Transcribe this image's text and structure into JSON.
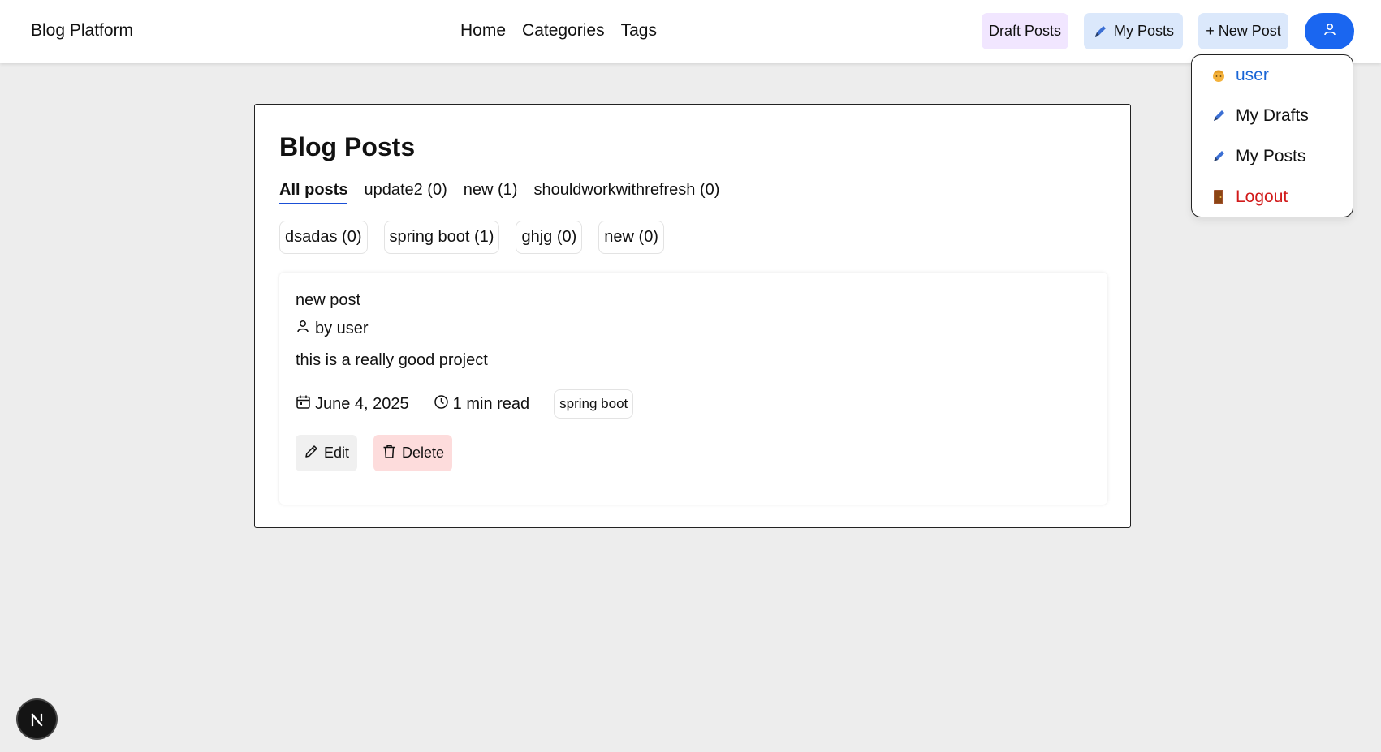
{
  "navbar": {
    "brand": "Blog Platform",
    "links": [
      "Home",
      "Categories",
      "Tags"
    ],
    "draft_posts_label": "Draft Posts",
    "my_posts_label": "My Posts",
    "new_post_label": "+ New Post"
  },
  "user_menu": {
    "username": "user",
    "my_drafts": "My Drafts",
    "my_posts": "My Posts",
    "logout": "Logout"
  },
  "main": {
    "title": "Blog Posts",
    "category_tabs": [
      "All posts",
      "update2 (0)",
      "new (1)",
      "shouldworkwithrefresh (0)"
    ],
    "active_tab": "All posts",
    "tag_filters": [
      "dsadas (0)",
      "spring boot (1)",
      "ghjg (0)",
      "new (0)"
    ],
    "posts": [
      {
        "title": "new post",
        "author": "by user",
        "excerpt": "this is a really good project",
        "date": "June 4, 2025",
        "read_time": "1 min read",
        "tag": "spring boot",
        "edit_label": "Edit",
        "delete_label": "Delete"
      }
    ]
  },
  "colors": {
    "background": "#ededed",
    "accent": "#1a66f0",
    "draft_button": "#f1e6ff",
    "primary_light": "#dbe8fb",
    "danger": "#d11a1a",
    "danger_light": "#fddcdc"
  },
  "icons": {
    "pen": "pen-icon",
    "avatar": "user-icon",
    "calendar": "calendar-icon",
    "clock": "clock-icon",
    "trash": "trash-icon",
    "door": "door-icon",
    "next": "nextjs-icon"
  }
}
